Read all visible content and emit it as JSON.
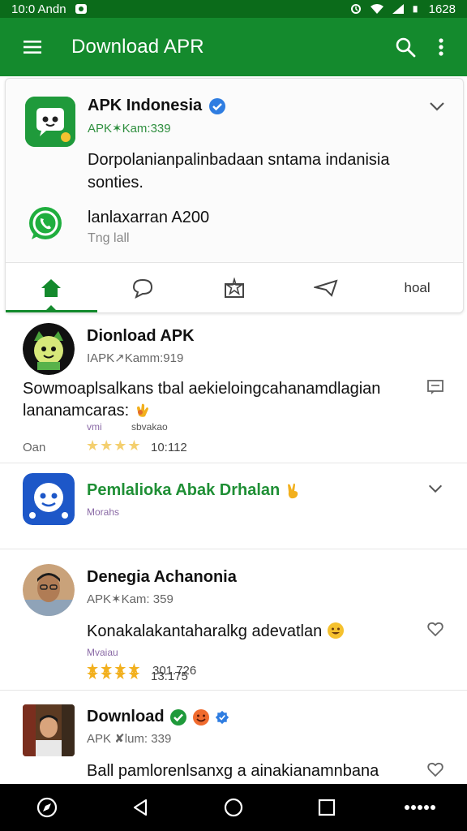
{
  "status_bar": {
    "time": "10:0 Andn",
    "clock": "1628"
  },
  "app_bar": {
    "title": "Download APR"
  },
  "header": {
    "name": "APK Indonesia",
    "subtitle": "APK✶Kam:339",
    "description": "Dorpolanianpalinbadaan sntama indanisia sonties.",
    "size": "lanlaxarran A200",
    "install": "Tng lall"
  },
  "tabs": [
    {
      "icon": "home-icon"
    },
    {
      "icon": "chat-bubble-icon"
    },
    {
      "icon": "star-board-icon"
    },
    {
      "icon": "send-icon"
    },
    {
      "label": "hoal"
    }
  ],
  "posts": [
    {
      "name": "Dionload APK",
      "subtitle": "IAPK↗Kamm:919",
      "text": "Sowmoaplsalkans tbal aekieloingcahanamdlagian lananamcaras:",
      "tiny_left": "vmi",
      "tiny_right": "sbvakao",
      "left_label": "Oan",
      "stars": "★★★★",
      "rating": "10:112"
    },
    {
      "name": "Pemlalioka Abak Drhalan",
      "tiny": "Morahs",
      "stars": "★★★★",
      "rating": "13:175"
    },
    {
      "name": "Denegia Achanonia",
      "subtitle": "APK✶Kam: 359",
      "text": "Konakalakantaharalkg adevatlan",
      "tiny": "Mvaiau",
      "stars": "★★★★",
      "rating": "301.726"
    },
    {
      "name": "Download",
      "subtitle": "APK ✘lum: 339",
      "text": "Ball pamlorenlsanxg a ainakianamnbana"
    }
  ],
  "colors": {
    "primary": "#148a2d",
    "status": "#0b6b1a",
    "star": "#f2b01e"
  }
}
